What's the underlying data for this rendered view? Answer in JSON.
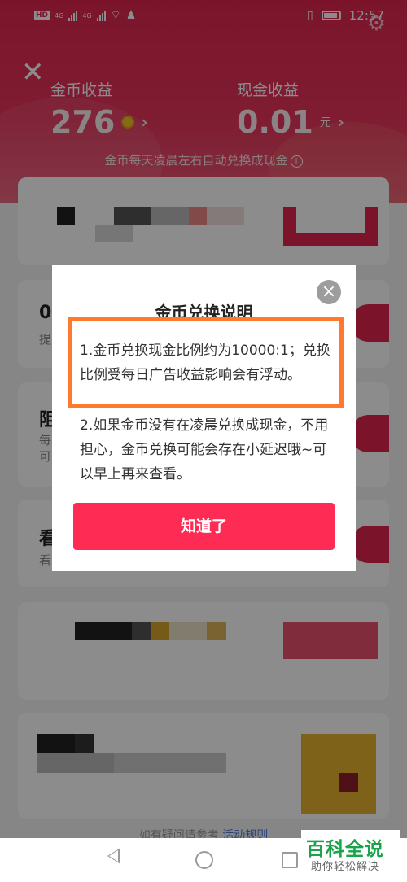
{
  "status_bar": {
    "left_badge": "HD",
    "signal_a": "4G",
    "signal_b": "4G",
    "time": "12:57"
  },
  "header": {
    "coin_label": "金币收益",
    "coin_value": "276",
    "cash_label": "现金收益",
    "cash_value": "0.01",
    "cash_unit": "元",
    "notice": "金币每天凌晨左右自动兑换成现金",
    "info_symbol": "i"
  },
  "background_cards": {
    "card2_text": "0.",
    "card2_sub": "提",
    "card3_text": "阻",
    "card3_sub1": "每",
    "card3_sub2": "可",
    "card4_text": "看",
    "card4_sub": "看"
  },
  "footer": {
    "hint": "如有疑问请参考",
    "link": "活动规则"
  },
  "dialog": {
    "title": "金币兑换说明",
    "close_symbol": "×",
    "para1": "1.金币兑换现金比例约为10000:1；兑换比例受每日广告收益影响会有浮动。",
    "para2": "2.如果金币没有在凌晨兑换成现金，不用担心，金币兑换可能会存在小延迟哦~可以早上再来查看。",
    "ok_label": "知道了"
  },
  "watermark": {
    "main": "百科全说",
    "sub": "助你轻松解决"
  },
  "colors": {
    "header_red": "#e0264e",
    "button_red": "#fe2c55",
    "highlight_orange": "#ff7a2e",
    "watermark_green": "#1aa34a"
  }
}
